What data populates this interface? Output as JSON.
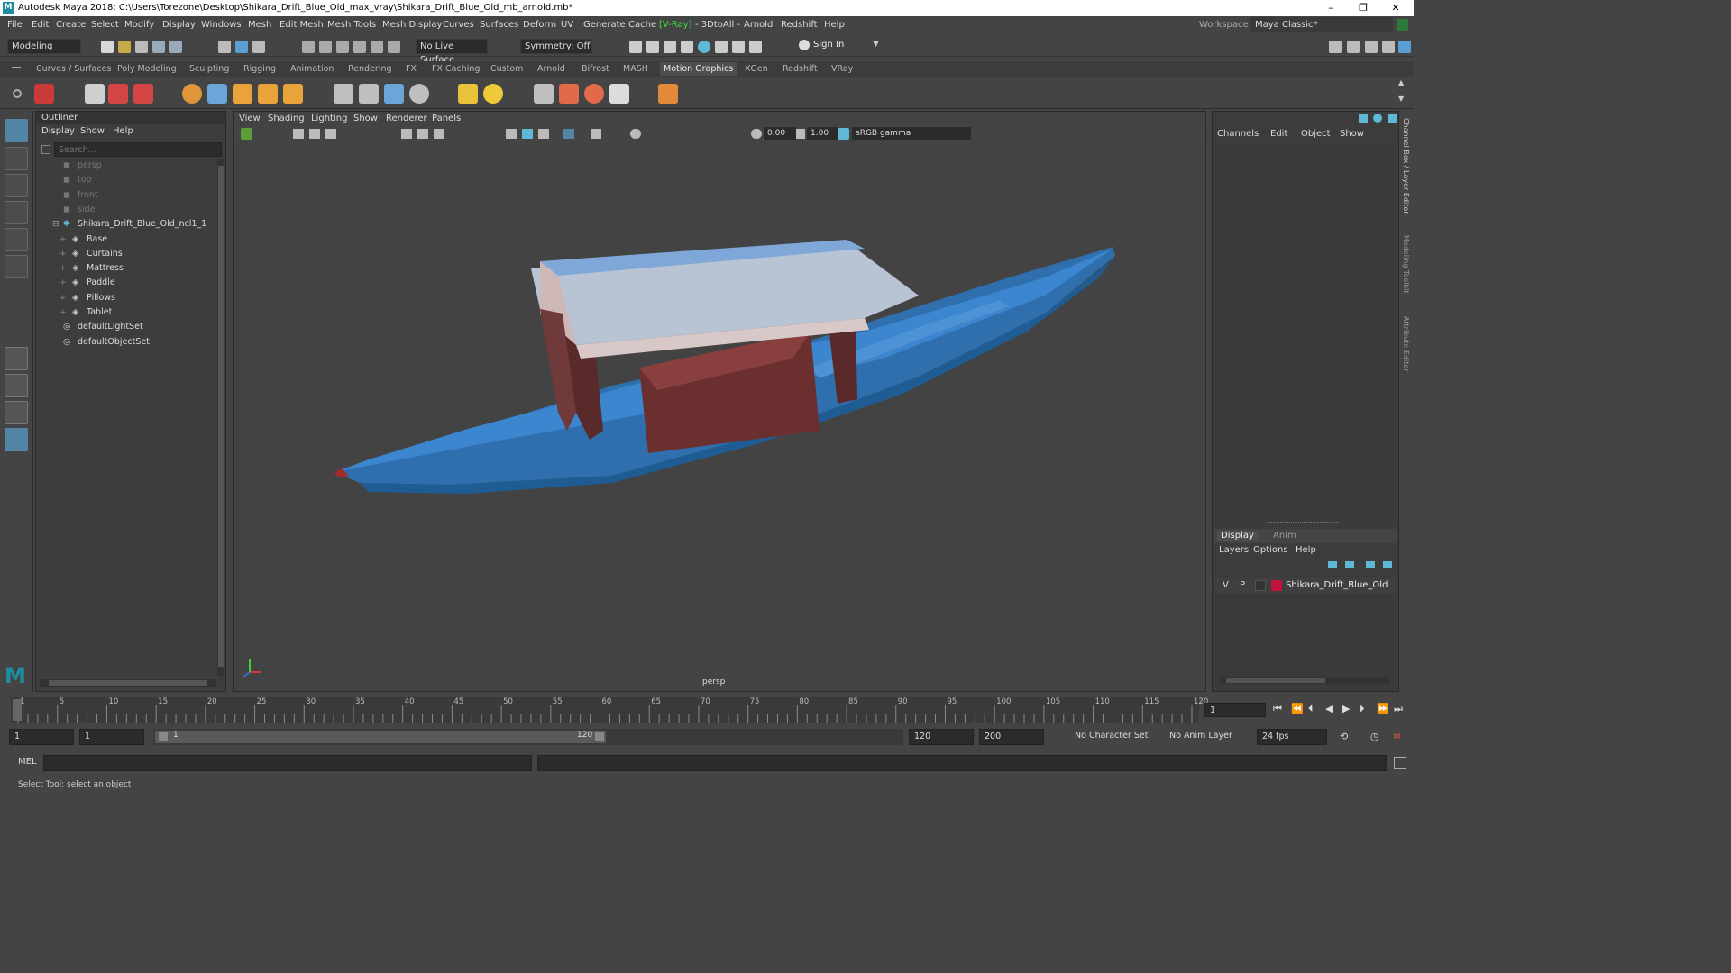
{
  "window": {
    "title": "Autodesk Maya 2018: C:\\Users\\Torezone\\Desktop\\Shikara_Drift_Blue_Old_max_vray\\Shikara_Drift_Blue_Old_mb_arnold.mb*",
    "controls": [
      "–",
      "❐",
      "✕"
    ]
  },
  "menubar": {
    "items": [
      "File",
      "Edit",
      "Create",
      "Select",
      "Modify",
      "Display",
      "Windows",
      "Mesh",
      "Edit Mesh",
      "Mesh Tools",
      "Mesh Display",
      "Curves",
      "Surfaces",
      "Deform",
      "UV",
      "Generate",
      "Cache",
      "[V-Ray]",
      "- 3DtoAll -",
      "Arnold",
      "Redshift",
      "Help"
    ],
    "workspace_label": "Workspace :",
    "workspace_value": "Maya Classic*"
  },
  "statusline": {
    "mode": "Modeling",
    "live_surface": "No Live Surface",
    "symmetry": "Symmetry: Off",
    "sign_in": "Sign In"
  },
  "shelf": {
    "tabs": [
      "Curves / Surfaces",
      "Poly Modeling",
      "Sculpting",
      "Rigging",
      "Animation",
      "Rendering",
      "FX",
      "FX Caching",
      "Custom",
      "Arnold",
      "Bifrost",
      "MASH",
      "Motion Graphics",
      "XGen",
      "Redshift",
      "VRay"
    ],
    "active_tab": "Motion Graphics"
  },
  "outliner": {
    "title": "Outliner",
    "menu": [
      "Display",
      "Show",
      "Help"
    ],
    "search_placeholder": "Search...",
    "items": [
      {
        "label": "persp",
        "kind": "camera",
        "dim": true
      },
      {
        "label": "top",
        "kind": "camera",
        "dim": true
      },
      {
        "label": "front",
        "kind": "camera",
        "dim": true
      },
      {
        "label": "side",
        "kind": "camera",
        "dim": true
      },
      {
        "label": "Shikara_Drift_Blue_Old_ncl1_1",
        "kind": "group",
        "dim": false
      },
      {
        "label": "Base",
        "kind": "mesh",
        "dim": false
      },
      {
        "label": "Curtains",
        "kind": "mesh",
        "dim": false
      },
      {
        "label": "Mattress",
        "kind": "mesh",
        "dim": false
      },
      {
        "label": "Paddle",
        "kind": "mesh",
        "dim": false
      },
      {
        "label": "Pillows",
        "kind": "mesh",
        "dim": false
      },
      {
        "label": "Tablet",
        "kind": "mesh",
        "dim": false
      },
      {
        "label": "defaultLightSet",
        "kind": "set",
        "dim": false
      },
      {
        "label": "defaultObjectSet",
        "kind": "set",
        "dim": false
      }
    ]
  },
  "viewport": {
    "menu": [
      "View",
      "Shading",
      "Lighting",
      "Show",
      "Renderer",
      "Panels"
    ],
    "exposure": "0.00",
    "gamma": "1.00",
    "color_space": "sRGB gamma",
    "camera_label": "persp"
  },
  "channelbox": {
    "menu": [
      "Channels",
      "Edit",
      "Object",
      "Show"
    ],
    "side_tabs": [
      "Channel Box / Layer Editor",
      "Modeling Toolkit",
      "Attribute Editor"
    ]
  },
  "layer_editor": {
    "tabs": [
      "Display",
      "Anim"
    ],
    "menu": [
      "Layers",
      "Options",
      "Help"
    ],
    "layer": {
      "visible": "V",
      "playback": "P",
      "name": "Shikara_Drift_Blue_Old",
      "color": "#c0143c"
    }
  },
  "timeline": {
    "ticks": [
      "1",
      "5",
      "10",
      "15",
      "20",
      "25",
      "30",
      "35",
      "40",
      "45",
      "50",
      "55",
      "60",
      "65",
      "70",
      "75",
      "80",
      "85",
      "90",
      "95",
      "100",
      "105",
      "110",
      "115",
      "120"
    ],
    "current_frame": "1"
  },
  "range": {
    "start": "1",
    "playback_start": "1",
    "slider_start": "1",
    "slider_end": "120",
    "playback_end": "120",
    "end": "200",
    "character_set": "No Character Set",
    "anim_layer": "No Anim Layer",
    "fps": "24 fps"
  },
  "commandline": {
    "label": "MEL",
    "help_text": "Select Tool: select an object"
  },
  "colors": {
    "accent": "#5285a6",
    "boat_blue": "#2f7bc4",
    "maya_logo": "#1e8fa3"
  }
}
